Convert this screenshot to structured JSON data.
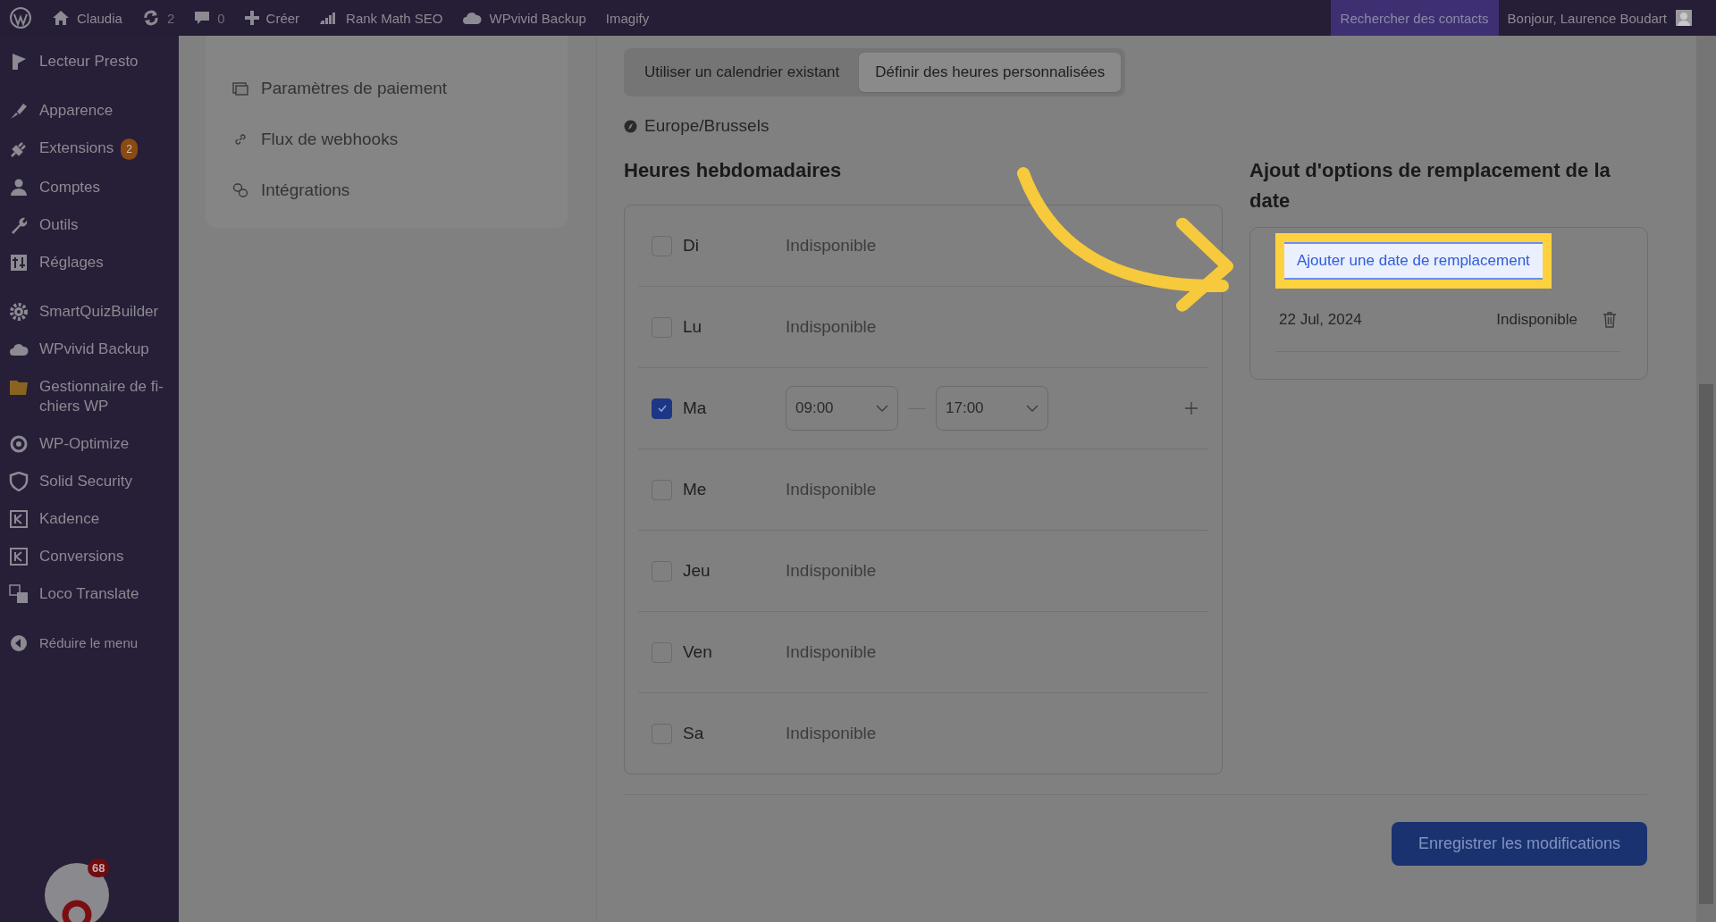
{
  "admin_bar": {
    "items": [
      {
        "kind": "logo"
      },
      {
        "kind": "home",
        "label": "Claudia"
      },
      {
        "kind": "updates",
        "label": "2"
      },
      {
        "kind": "comments",
        "label": "0"
      },
      {
        "kind": "new",
        "label": "Créer"
      },
      {
        "kind": "rankmath",
        "label": "Rank Math SEO"
      },
      {
        "kind": "cloud",
        "label": "WPvivid Backup"
      },
      {
        "kind": "plain",
        "label": "Imagify"
      }
    ],
    "search_contacts": "Rechercher des contacts",
    "greeting": "Bonjour, Laurence Boudart"
  },
  "sidebar": {
    "items": [
      {
        "label": "Lecteur Presto"
      },
      {
        "label": "Apparence"
      },
      {
        "label": "Extensions",
        "badge": "2"
      },
      {
        "label": "Comptes"
      },
      {
        "label": "Outils"
      },
      {
        "label": "Réglages"
      },
      {
        "label": "SmartQuizBuilder"
      },
      {
        "label": "WPvivid Backup"
      },
      {
        "label": "Gestionnaire de fi-\nchiers WP"
      },
      {
        "label": "WP-Optimize"
      },
      {
        "label": "Solid Security"
      },
      {
        "label": "Kadence"
      },
      {
        "label": "Conversions"
      },
      {
        "label": "Loco Translate"
      },
      {
        "label": "Réduire le menu"
      }
    ],
    "widget_badge": "68"
  },
  "settings_nav": [
    {
      "label": "Paramètres de paiement"
    },
    {
      "label": "Flux de webhooks"
    },
    {
      "label": "Intégrations"
    }
  ],
  "tabs": [
    {
      "label": "Utiliser un calendrier existant",
      "selected": false
    },
    {
      "label": "Définir des heures personnalisées",
      "selected": true
    }
  ],
  "timezone": "Europe/Brussels",
  "weekly": {
    "title": "Heures hebdomadaires",
    "days": [
      {
        "label": "Di",
        "checked": false,
        "status": "Indisponible"
      },
      {
        "label": "Lu",
        "checked": false,
        "status": "Indisponible"
      },
      {
        "label": "Ma",
        "checked": true,
        "start": "09:00",
        "end": "17:00"
      },
      {
        "label": "Me",
        "checked": false,
        "status": "Indisponible"
      },
      {
        "label": "Jeu",
        "checked": false,
        "status": "Indisponible"
      },
      {
        "label": "Ven",
        "checked": false,
        "status": "Indisponible"
      },
      {
        "label": "Sa",
        "checked": false,
        "status": "Indisponible"
      }
    ]
  },
  "overrides": {
    "title": "Ajout d'options de remplacement de la date",
    "add_button": "Ajouter une date de remplacement",
    "rows": [
      {
        "date": "22 Jul, 2024",
        "status": "Indisponible"
      }
    ]
  },
  "save_button": "Enregistrer les modifications"
}
